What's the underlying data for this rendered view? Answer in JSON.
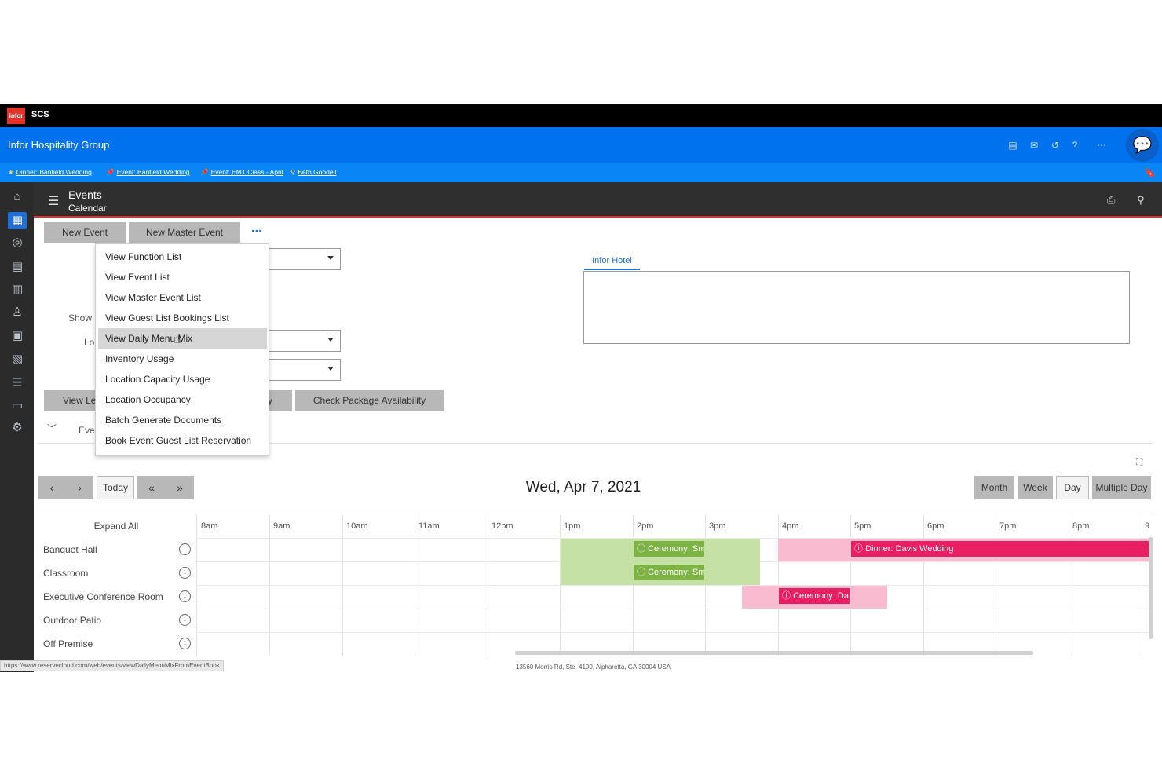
{
  "app": {
    "logo_text": "infor",
    "name": "SCS"
  },
  "header": {
    "title": "Infor Hospitality Group"
  },
  "favorites": [
    {
      "label": "Dinner: Banfield Wedding",
      "star_color": "#ff6b5b"
    },
    {
      "label": "Event: Banfield Wedding",
      "star_color": "#ff6b5b"
    },
    {
      "label": "Event: EMT Class - April",
      "star_color": "#ff6b5b"
    },
    {
      "label": "Beth Goodell",
      "star_color": "#ffd34d"
    }
  ],
  "page": {
    "title": "Events",
    "subtitle": "Calendar"
  },
  "toolbar": {
    "new_event": "New Event",
    "new_master_event": "New Master Event",
    "more": "⋯"
  },
  "menu": {
    "items": [
      "View Function List",
      "View Event List",
      "View Master Event List",
      "View Guest List Bookings List",
      "View Daily Menu Mix",
      "Inventory Usage",
      "Location Capacity Usage",
      "Location Occupancy",
      "Batch Generate Documents",
      "Book Event Guest List Reservation"
    ],
    "hovered_index": 4
  },
  "form": {
    "show_label": "Show I",
    "location_label": "Lo",
    "view_button": "View Le",
    "hidden_button": "y",
    "check_package": "Check Package Availability",
    "events_section": "Eve"
  },
  "hotel_tab": {
    "label": "Infor Hotel"
  },
  "calendar": {
    "date_label": "Wed, Apr 7, 2021",
    "today": "Today",
    "prev": "‹",
    "next": "›",
    "prev_fast": "«",
    "next_fast": "»",
    "views": [
      "Month",
      "Week",
      "Day",
      "Multiple Day"
    ],
    "selected_view": "Day",
    "expand_all": "Expand All",
    "hours": [
      "8am",
      "9am",
      "10am",
      "11am",
      "12pm",
      "1pm",
      "2pm",
      "3pm",
      "4pm",
      "5pm",
      "6pm",
      "7pm",
      "8pm",
      "9"
    ],
    "resources": [
      "Banquet Hall",
      "Classroom",
      "Executive Conference Room",
      "Outdoor Patio",
      "Off Premise"
    ],
    "events": [
      {
        "label": "Ceremony: Sm",
        "color": "#7cb342"
      },
      {
        "label": "Ceremony: Sm",
        "color": "#7cb342"
      },
      {
        "label": "Ceremony: Da",
        "color": "#e91e63"
      },
      {
        "label": "Dinner: Davis Wedding",
        "color": "#e91e63"
      }
    ]
  },
  "status": {
    "url": "https://www.reservecloud.com/web/events/viewDailyMenuMixFromEventBook",
    "address": "13560 Morris Rd, Ste. 4100, Alpharetta, GA 30004 USA"
  },
  "colors": {
    "brand_blue": "#0072ed",
    "accent_red": "#e4322b",
    "event_green": "#8bc34a",
    "event_pink": "#e91e63"
  }
}
